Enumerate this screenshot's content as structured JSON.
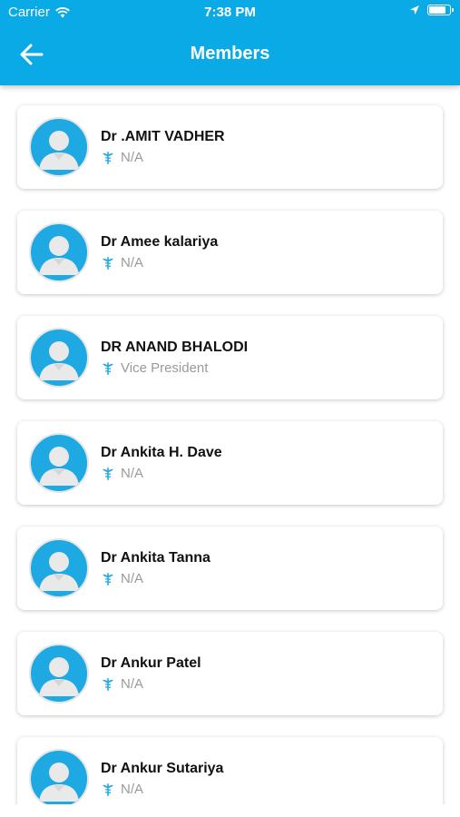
{
  "status_bar": {
    "carrier": "Carrier",
    "time": "7:38 PM",
    "battery_level": 0.9
  },
  "header": {
    "title": "Members",
    "back_icon": "arrow-left-icon"
  },
  "colors": {
    "primary": "#0aaae6",
    "avatar_bg": "#1ea9e3",
    "role_icon": "#27a9e1"
  },
  "members": [
    {
      "name": "Dr .AMIT VADHER",
      "role": "N/A"
    },
    {
      "name": "Dr Amee kalariya",
      "role": "N/A"
    },
    {
      "name": "DR ANAND BHALODI",
      "role": "Vice President"
    },
    {
      "name": "Dr Ankita H. Dave",
      "role": "N/A"
    },
    {
      "name": "Dr Ankita Tanna",
      "role": "N/A"
    },
    {
      "name": "Dr Ankur Patel",
      "role": "N/A"
    },
    {
      "name": "Dr Ankur Sutariya",
      "role": "N/A"
    }
  ]
}
